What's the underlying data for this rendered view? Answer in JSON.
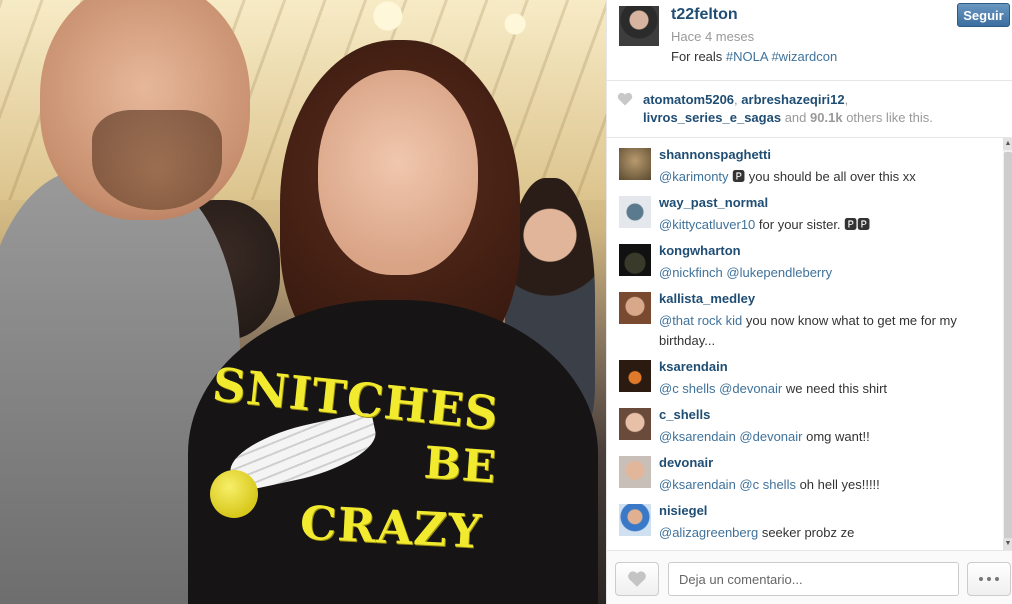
{
  "post": {
    "username": "t22felton",
    "time_ago": "Hace 4 meses",
    "caption_text": "For reals ",
    "hashtags": [
      "#NOLA",
      "#wizardcon"
    ],
    "follow_label": "Seguir"
  },
  "photo": {
    "shirt_lines": [
      "SNITCHES",
      "BE",
      "CRAZY"
    ]
  },
  "likes": {
    "users": [
      "atomatom5206",
      "arbreshazeqiri12",
      "livros_series_e_sagas"
    ],
    "and_text": "and",
    "others_count": "90.1k",
    "others_text": "others like this."
  },
  "comments": [
    {
      "user": "shannonspaghetti",
      "mention": "@karimonty",
      "text": " 🅿 you should be all over this xx"
    },
    {
      "user": "way_past_normal",
      "mention": "@kittycatluver10",
      "text": " for your sister. 🅿🅿"
    },
    {
      "user": "kongwharton",
      "mention": "@nickfinch @lukependleberry",
      "text": ""
    },
    {
      "user": "kallista_medley",
      "mention": "@that  rock  kid",
      "text": " you now know what to get me for my birthday..."
    },
    {
      "user": "ksarendain",
      "mention": "@c  shells @devonair",
      "text": " we need this shirt"
    },
    {
      "user": "c_shells",
      "mention": "@ksarendain @devonair",
      "text": " omg want!!"
    },
    {
      "user": "devonair",
      "mention": "@ksarendain @c  shells",
      "text": " oh hell yes!!!!!"
    },
    {
      "user": "nisiegel",
      "mention": "@alizagreenberg",
      "text": " seeker probz ze"
    }
  ],
  "footer": {
    "comment_placeholder": "Deja un comentario..."
  },
  "icons": {
    "heart": "heart-icon",
    "more": "more-dots-icon"
  },
  "colors": {
    "link": "#1f4d73",
    "hashtag": "#3f729b",
    "follow_button": "#3b6f9f"
  }
}
